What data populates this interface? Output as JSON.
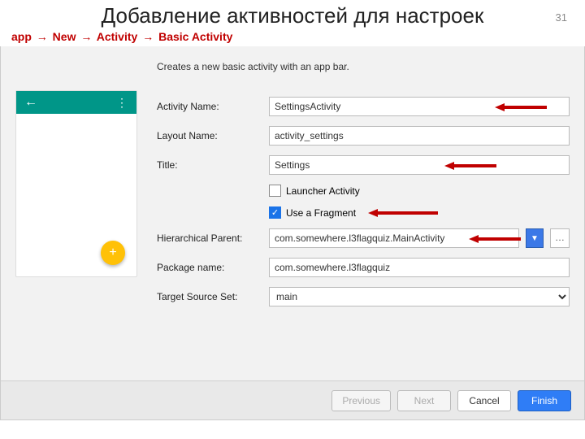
{
  "page_number": "31",
  "title": "Добавление активностей для настроек",
  "breadcrumb": [
    "app",
    "New",
    "Activity",
    "Basic Activity"
  ],
  "breadcrumb_sep": "→",
  "dialog": {
    "description": "Creates a new basic activity with an app bar.",
    "fields": {
      "activity_name": {
        "label": "Activity Name:",
        "value": "SettingsActivity"
      },
      "layout_name": {
        "label": "Layout Name:",
        "value": "activity_settings"
      },
      "title": {
        "label": "Title:",
        "value": "Settings"
      },
      "launcher": {
        "label": "Launcher Activity",
        "checked": false
      },
      "fragment": {
        "label": "Use a Fragment",
        "checked": true
      },
      "parent": {
        "label": "Hierarchical Parent:",
        "value": "com.somewhere.l3flagquiz.MainActivity"
      },
      "package": {
        "label": "Package name:",
        "value": "com.somewhere.l3flagquiz"
      },
      "source_set": {
        "label": "Target Source Set:",
        "value": "main"
      }
    },
    "buttons": {
      "previous": "Previous",
      "next": "Next",
      "cancel": "Cancel",
      "finish": "Finish"
    },
    "preview": {
      "back_icon": "←",
      "menu_icon": "⋮",
      "fab_icon": "+"
    }
  }
}
